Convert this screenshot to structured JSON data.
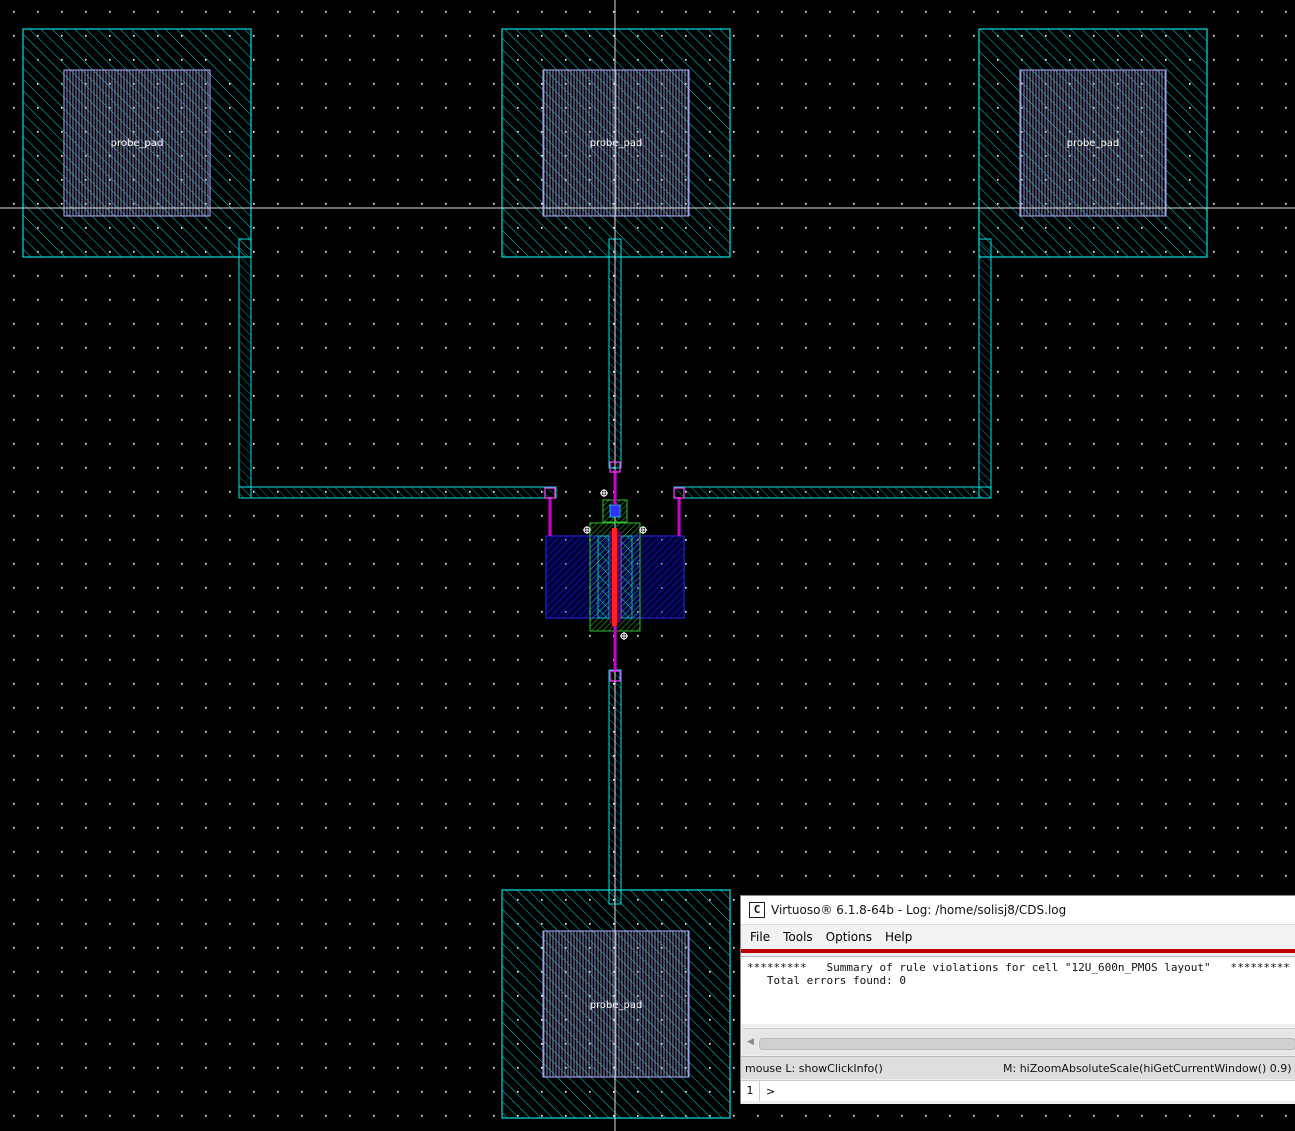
{
  "layout": {
    "pad_label": "probe_pad",
    "colors": {
      "background": "#000000",
      "grid_dot": "#ffffff",
      "metal": "#00e0e0",
      "diffusion": "#0000c8",
      "poly": "#ff2020",
      "via": "#ff40ff",
      "implant": "#20c020",
      "pad_opening": "#b0b0ff"
    }
  },
  "log_window": {
    "title": "Virtuoso® 6.1.8-64b - Log: /home/solisj8/CDS.log",
    "app_icon": "C",
    "menu": [
      "File",
      "Tools",
      "Options",
      "Help"
    ],
    "log_line1": "*********   Summary of rule violations for cell \"12U_600n_PMOS layout\"   *********",
    "log_line2": "   Total errors found: 0",
    "status_left": "mouse L: showClickInfo()",
    "status_right": "M: hiZoomAbsoluteScale(hiGetCurrentWindow() 0.9)",
    "cmd_number": "1",
    "cmd_prompt": ">"
  }
}
